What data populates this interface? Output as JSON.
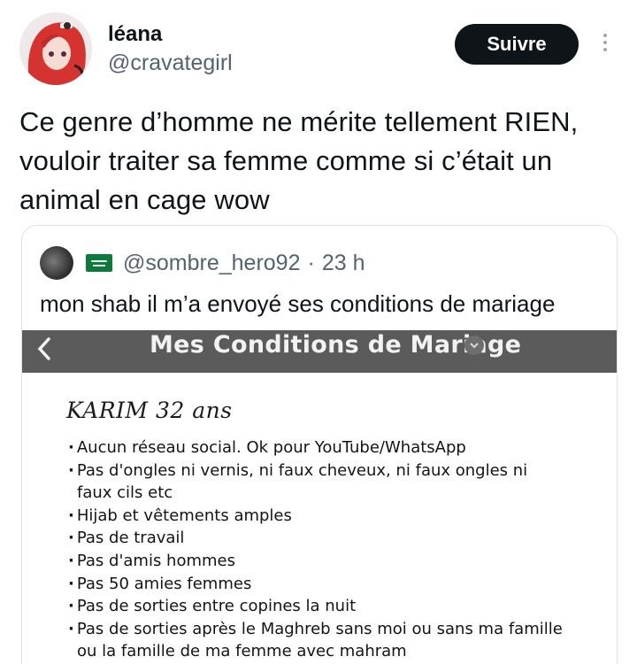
{
  "author": {
    "display_name": "léana",
    "handle": "@cravategirl",
    "avatar_icon": "anime-avatar-red-hair"
  },
  "actions": {
    "follow_label": "Suivre",
    "more_icon": "more-vertical-icon"
  },
  "tweet": {
    "lines": [
      "Ce genre d’homme ne mérite tellement RIEN,",
      "vouloir traiter sa femme comme si c’était un",
      "animal en cage wow"
    ]
  },
  "quote": {
    "flag_icon": "saudi-flag-icon",
    "handle": "@sombre_hero92",
    "separator": "·",
    "time": "23 h",
    "text": "mon shab il m’a envoyé ses conditions de mariage",
    "image": {
      "title": "Mes Conditions de Mariage",
      "heading": "KARIM 32 ans",
      "conditions": [
        "Aucun réseau social. Ok pour YouTube/WhatsApp",
        "Pas d'ongles ni vernis, ni faux cheveux, ni faux ongles ni faux cils etc",
        "Hijab et vêtements amples",
        "Pas de travail",
        "Pas d'amis hommes",
        "Pas 50 amies femmes",
        "Pas de sorties entre copines la nuit",
        "Pas de sorties après le Maghreb sans moi ou sans ma famille ou la famille de ma femme avec mahram"
      ]
    }
  },
  "colors": {
    "text": "#0f1419",
    "secondary": "#536471",
    "follow_bg": "#0f1419",
    "image_bar": "#5b5b5b"
  }
}
